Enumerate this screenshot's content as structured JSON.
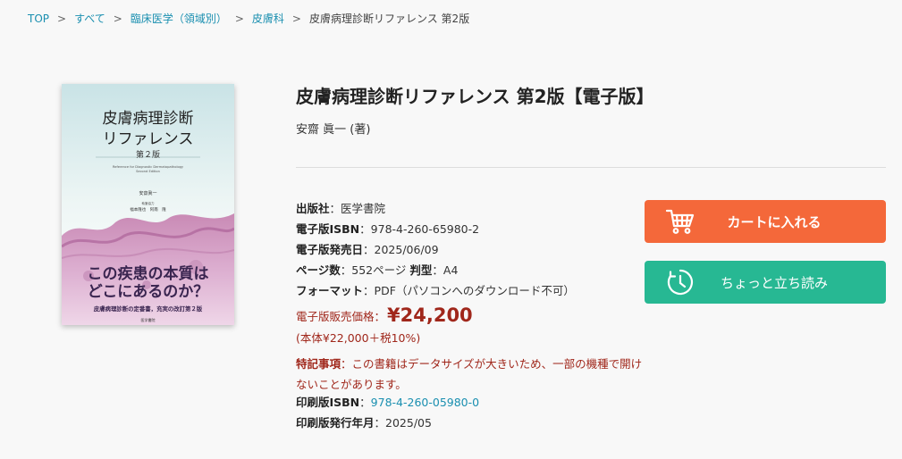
{
  "breadcrumb": {
    "items": [
      "TOP",
      "すべて",
      "臨床医学（領域別）",
      "皮膚科"
    ],
    "separator": ">",
    "current": "皮膚病理診断リファレンス 第2版"
  },
  "cover": {
    "title_line1": "皮膚病理診断",
    "title_line2": "リファレンス",
    "edition": "第２版",
    "english_line1": "Reference for Diagnostic Dermatopathology",
    "english_line2": "Second Edition",
    "author": "安齋眞一",
    "cooperation_label": "執筆協力",
    "coauthors": "福本隆也　阿南　隆",
    "catch_line1": "この疾患の本質は",
    "catch_line2": "どこにあるのか？",
    "subcatch": "皮膚病理診断の定番書，充実の改訂第２版",
    "publisher": "医学書院"
  },
  "product": {
    "title": "皮膚病理診断リファレンス 第2版【電子版】",
    "author": "安齋 眞一 (著)"
  },
  "details": {
    "publisher_label": "出版社",
    "publisher_value": "医学書院",
    "eisbn_label": "電子版ISBN",
    "eisbn_value": "978-4-260-65980-2",
    "release_label": "電子版発売日",
    "release_value": "2025/06/09",
    "pages_label": "ページ数",
    "pages_value": "552ページ",
    "size_label": "判型",
    "size_value": "A4",
    "format_label": "フォーマット",
    "format_value": "PDF（パソコンへのダウンロード不可）",
    "price_label": "電子版販売価格：",
    "price_value": "¥24,200",
    "tax_note": "(本体¥22,000＋税10%)",
    "notes_label": "特記事項",
    "notes_value": "この書籍はデータサイズが大きいため、一部の機種で開けないことがあります。",
    "print_isbn_label": "印刷版ISBN",
    "print_isbn_value": "978-4-260-05980-0",
    "print_date_label": "印刷版発行年月",
    "print_date_value": "2025/05"
  },
  "buttons": {
    "cart_label": "カートに入れる",
    "preview_label": "ちょっと立ち読み"
  },
  "colors": {
    "accent_orange": "#f4683a",
    "accent_green": "#27b893",
    "link_blue": "#1a8fb0",
    "price_red": "#a0271b"
  },
  "icons": {
    "cart": "shopping-cart-icon",
    "preview": "clock-icon"
  }
}
